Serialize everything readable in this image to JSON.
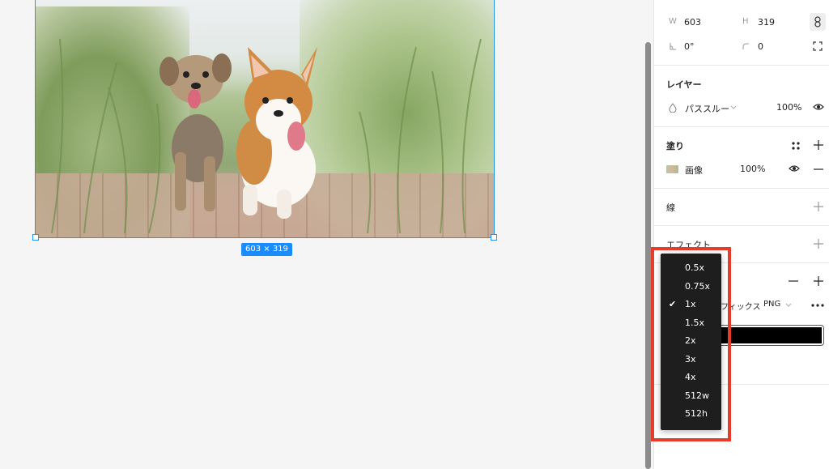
{
  "canvas": {
    "dimension_badge": "603 × 319"
  },
  "panel": {
    "size": {
      "w_label": "W",
      "w_value": "603",
      "h_label": "H",
      "h_value": "319",
      "rotation_value": "0°",
      "radius_value": "0"
    },
    "layer": {
      "title": "レイヤー",
      "blend_mode": "パススルー",
      "opacity": "100%"
    },
    "fill": {
      "title": "塗り",
      "type_label": "画像",
      "opacity": "100%"
    },
    "stroke": {
      "title": "線"
    },
    "effect": {
      "title": "エフェクト"
    },
    "export": {
      "suffix_placeholder": "フィックス",
      "format": "PNG"
    }
  },
  "dropdown": {
    "selected": "1x",
    "options": [
      "0.5x",
      "0.75x",
      "1x",
      "1.5x",
      "2x",
      "3x",
      "4x",
      "512w",
      "512h"
    ]
  },
  "colors": {
    "selection": "#2196f3",
    "badge": "#1a8cff",
    "highlight": "#e53d2a",
    "dropdown_bg": "#1e1e1e"
  }
}
